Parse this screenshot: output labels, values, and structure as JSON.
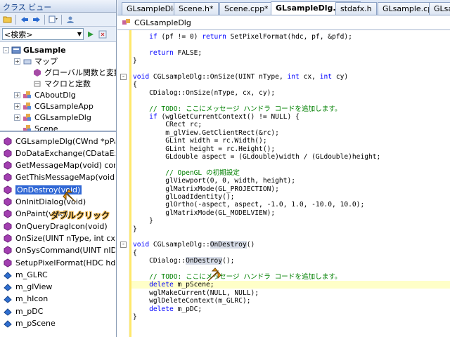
{
  "class_view": {
    "title": "クラス ビュー",
    "search_placeholder": "<検索>",
    "tree": [
      {
        "label": "GLsample",
        "expand": "-",
        "icon": "project-icon"
      },
      {
        "label": "マップ",
        "expand": "+",
        "icon": "map-folder-icon"
      },
      {
        "label": "グローバル関数と変数",
        "expand": "",
        "icon": "global-icon"
      },
      {
        "label": "マクロと定数",
        "expand": "",
        "icon": "macro-icon"
      },
      {
        "label": "CAboutDlg",
        "expand": "+",
        "icon": "class-icon"
      },
      {
        "label": "CGLsampleApp",
        "expand": "+",
        "icon": "class-icon"
      },
      {
        "label": "CGLsampleDlg",
        "expand": "+",
        "icon": "class-icon"
      },
      {
        "label": "Scene",
        "expand": "",
        "icon": "class-icon"
      }
    ],
    "members": [
      "CGLsampleDlg(CWnd *pPar",
      "DoDataExchange(CDataExc",
      "GetMessageMap(void) const",
      "GetThisMessageMap(void)",
      "OnDestroy(void)",
      "OnInitDialog(void)",
      "OnPaint(void)",
      "OnQueryDragIcon(void)",
      "OnSize(UINT nType, int cx,",
      "OnSysCommand(UINT nID,",
      "SetupPixelFormat(HDC hdc)",
      "m_GLRC",
      "m_glView",
      "m_hIcon",
      "m_pDC",
      "m_pScene"
    ],
    "selected_member": "OnDestroy(void)"
  },
  "annotation": {
    "label": "ダブルクリック",
    "color": "#ffa31a"
  },
  "editor": {
    "tabs": [
      "GLsampleDlg.h*",
      "Scene.h*",
      "Scene.cpp*",
      "GLsampleDlg.cpp*",
      "stdafx.h",
      "GLsample.cpp",
      "GLsample"
    ],
    "active_tab": "GLsampleDlg.cpp*",
    "nav_class": "CGLsampleDlg",
    "code_lines": [
      "    if (pf != 0) return SetPixelFormat(hdc, pf, &pfd);",
      "",
      "    return FALSE;",
      "}",
      "",
      "void CGLsampleDlg::OnSize(UINT nType, int cx, int cy)",
      "{",
      "    CDialog::OnSize(nType, cx, cy);",
      "",
      "    // TODO: ここにメッセージ ハンドラ コードを追加します。",
      "    if (wglGetCurrentContext() != NULL) {",
      "        CRect rc;",
      "        m_glView.GetClientRect(&rc);",
      "        GLint width = rc.Width();",
      "        GLint height = rc.Height();",
      "        GLdouble aspect = (GLdouble)width / (GLdouble)height;",
      "",
      "        // OpenGL の初期設定",
      "        glViewport(0, 0, width, height);",
      "        glMatrixMode(GL_PROJECTION);",
      "        glLoadIdentity();",
      "        glOrtho(-aspect, aspect, -1.0, 1.0, -10.0, 10.0);",
      "        glMatrixMode(GL_MODELVIEW);",
      "    }",
      "}",
      "",
      "void CGLsampleDlg::OnDestroy()",
      "{",
      "    CDialog::OnDestroy();",
      "",
      "    // TODO: ここにメッセージ ハンドラ コードを追加します。",
      "    delete m_pScene;",
      "    wglMakeCurrent(NULL, NULL);",
      "    wglDeleteContext(m_GLRC);",
      "    delete m_pDC;",
      "}"
    ]
  },
  "colors": {
    "keyword": "#0000ff",
    "comment": "#008000",
    "selection": "#3168d5",
    "current_line": "#ffffc8"
  }
}
